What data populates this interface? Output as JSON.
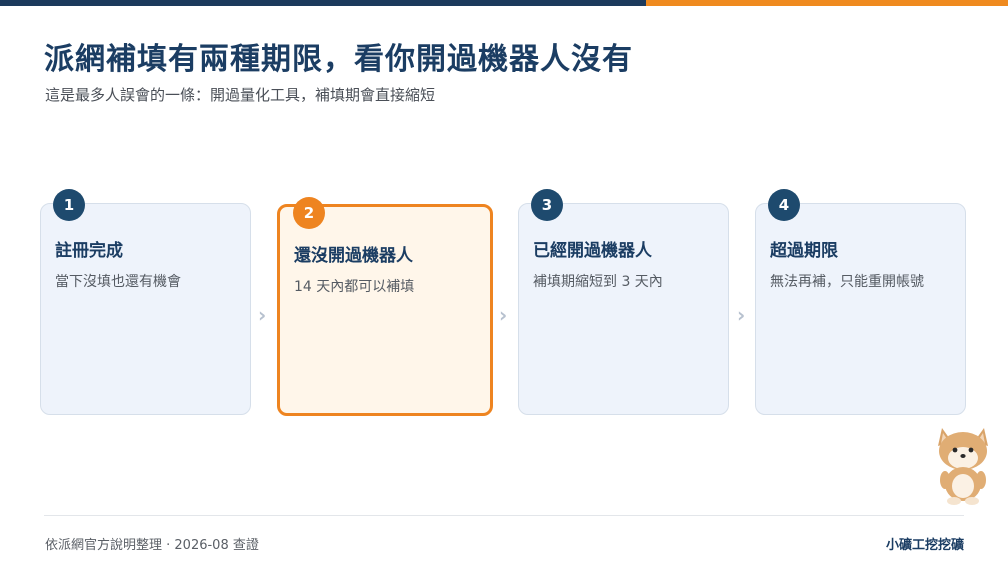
{
  "title": "派網補填有兩種期限，看你開過機器人沒有",
  "subtitle": "這是最多人誤會的一條：開過量化工具，補填期會直接縮短",
  "steps": [
    {
      "num": "1",
      "title": "註冊完成",
      "desc": "當下沒填也還有機會"
    },
    {
      "num": "2",
      "title": "還沒開過機器人",
      "desc": "14 天內都可以補填"
    },
    {
      "num": "3",
      "title": "已經開過機器人",
      "desc": "補填期縮短到 3 天內"
    },
    {
      "num": "4",
      "title": "超過期限",
      "desc": "無法再補，只能重開帳號"
    }
  ],
  "footer": {
    "note": "依派網官方說明整理 · 2026-08 查證",
    "brand": "小礦工挖挖礦"
  },
  "icons": {
    "arrow": "chevron-right-icon",
    "mascot": "shiba-mascot-icon"
  },
  "colors": {
    "navy": "#1c3a5c",
    "accent": "#ef8a1f",
    "card_bg": "#eef3fb",
    "active_bg": "#fff6ea"
  }
}
